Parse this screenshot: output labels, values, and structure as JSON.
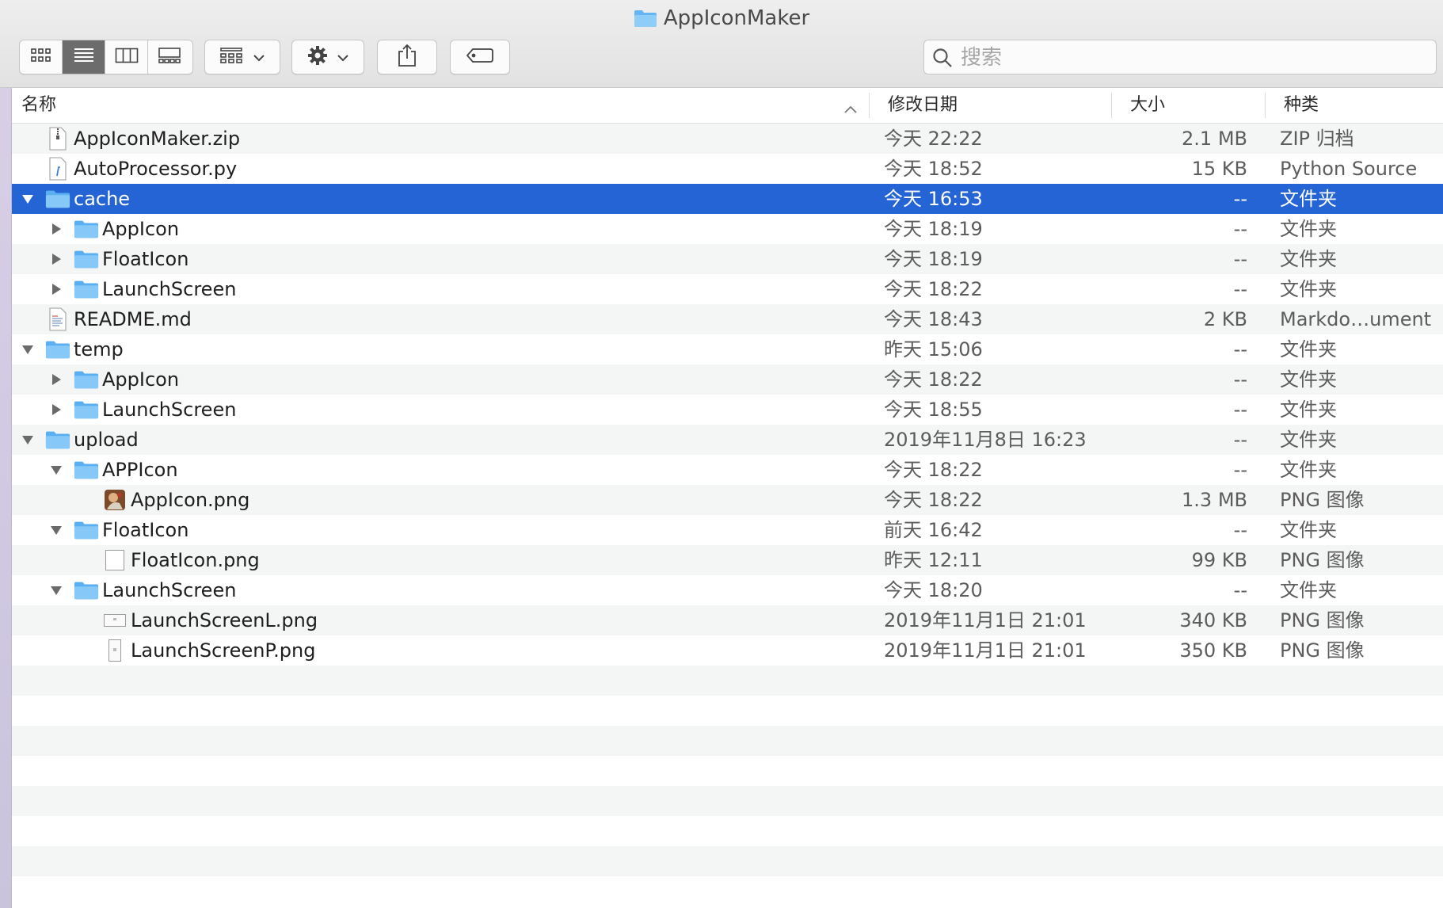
{
  "window": {
    "title": "AppIconMaker"
  },
  "toolbar": {
    "search_placeholder": "搜索",
    "icons": [
      "icon-view-icon",
      "list-view-icon",
      "column-view-icon",
      "gallery-view-icon",
      "group-icon",
      "chevron-down-icon",
      "gear-icon",
      "share-icon",
      "tag-icon",
      "search-icon"
    ]
  },
  "columns": {
    "name": "名称",
    "date": "修改日期",
    "size": "大小",
    "kind": "种类"
  },
  "colors": {
    "selection": "#2464d5",
    "folder": "#64b5f6",
    "stripe": "#f4f5f5"
  },
  "rows": [
    {
      "name": "AppIconMaker.zip",
      "date": "今天 22:22",
      "size": "2.1 MB",
      "kind": "ZIP 归档",
      "icon": "zip-file-icon",
      "level": 0,
      "expanded": null,
      "selected": false
    },
    {
      "name": "AutoProcessor.py",
      "date": "今天 18:52",
      "size": "15 KB",
      "kind": "Python Source",
      "icon": "python-file-icon",
      "level": 0,
      "expanded": null,
      "selected": false
    },
    {
      "name": "cache",
      "date": "今天 16:53",
      "size": "--",
      "kind": "文件夹",
      "icon": "folder-icon",
      "level": 0,
      "expanded": true,
      "selected": true
    },
    {
      "name": "AppIcon",
      "date": "今天 18:19",
      "size": "--",
      "kind": "文件夹",
      "icon": "folder-icon",
      "level": 1,
      "expanded": false,
      "selected": false
    },
    {
      "name": "FloatIcon",
      "date": "今天 18:19",
      "size": "--",
      "kind": "文件夹",
      "icon": "folder-icon",
      "level": 1,
      "expanded": false,
      "selected": false
    },
    {
      "name": "LaunchScreen",
      "date": "今天 18:22",
      "size": "--",
      "kind": "文件夹",
      "icon": "folder-icon",
      "level": 1,
      "expanded": false,
      "selected": false
    },
    {
      "name": "README.md",
      "date": "今天 18:43",
      "size": "2 KB",
      "kind": "Markdo…ument",
      "icon": "markdown-file-icon",
      "level": 0,
      "expanded": null,
      "selected": false
    },
    {
      "name": "temp",
      "date": "昨天 15:06",
      "size": "--",
      "kind": "文件夹",
      "icon": "folder-icon",
      "level": 0,
      "expanded": true,
      "selected": false
    },
    {
      "name": "AppIcon",
      "date": "今天 18:22",
      "size": "--",
      "kind": "文件夹",
      "icon": "folder-icon",
      "level": 1,
      "expanded": false,
      "selected": false
    },
    {
      "name": "LaunchScreen",
      "date": "今天 18:55",
      "size": "--",
      "kind": "文件夹",
      "icon": "folder-icon",
      "level": 1,
      "expanded": false,
      "selected": false
    },
    {
      "name": "upload",
      "date": "2019年11月8日 16:23",
      "size": "--",
      "kind": "文件夹",
      "icon": "folder-icon",
      "level": 0,
      "expanded": true,
      "selected": false
    },
    {
      "name": "APPIcon",
      "date": "今天 18:22",
      "size": "--",
      "kind": "文件夹",
      "icon": "folder-icon",
      "level": 1,
      "expanded": true,
      "selected": false
    },
    {
      "name": "AppIcon.png",
      "date": "今天 18:22",
      "size": "1.3 MB",
      "kind": "PNG 图像",
      "icon": "image-thumbnail-icon",
      "level": 2,
      "expanded": null,
      "selected": false
    },
    {
      "name": "FloatIcon",
      "date": "前天 16:42",
      "size": "--",
      "kind": "文件夹",
      "icon": "folder-icon",
      "level": 1,
      "expanded": true,
      "selected": false
    },
    {
      "name": "FloatIcon.png",
      "date": "昨天 12:11",
      "size": "99 KB",
      "kind": "PNG 图像",
      "icon": "blank-png-icon",
      "level": 2,
      "expanded": null,
      "selected": false
    },
    {
      "name": "LaunchScreen",
      "date": "今天 18:20",
      "size": "--",
      "kind": "文件夹",
      "icon": "folder-icon",
      "level": 1,
      "expanded": true,
      "selected": false
    },
    {
      "name": "LaunchScreenL.png",
      "date": "2019年11月1日 21:01",
      "size": "340 KB",
      "kind": "PNG 图像",
      "icon": "landscape-png-icon",
      "level": 2,
      "expanded": null,
      "selected": false
    },
    {
      "name": "LaunchScreenP.png",
      "date": "2019年11月1日 21:01",
      "size": "350 KB",
      "kind": "PNG 图像",
      "icon": "portrait-png-icon",
      "level": 2,
      "expanded": null,
      "selected": false
    }
  ]
}
